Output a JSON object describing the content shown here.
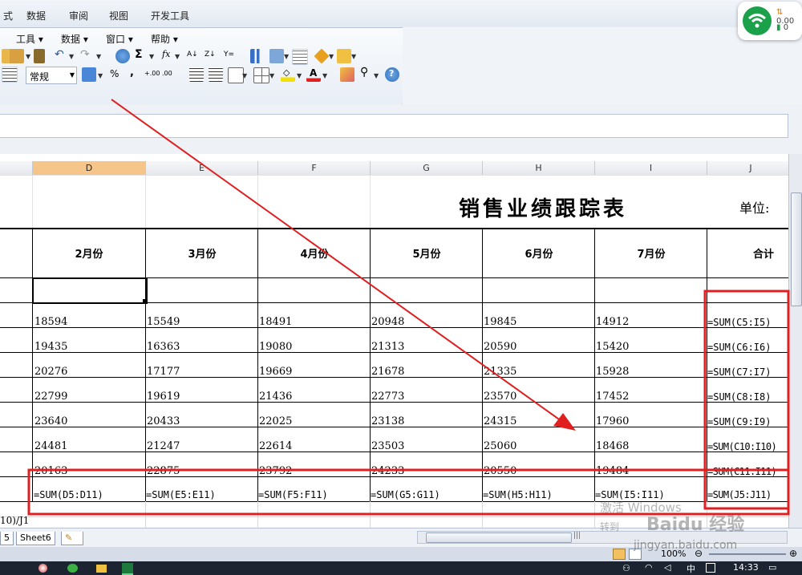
{
  "ribbon": {
    "tabs": [
      "式",
      "数据",
      "审阅",
      "视图",
      "开发工具"
    ]
  },
  "menu": {
    "items": [
      "工具",
      "数据",
      "窗口",
      "帮助"
    ]
  },
  "toolbar": {
    "number_format": "常规",
    "percent": "%",
    "comma": ",",
    "sigma": "Σ",
    "fx": "fx"
  },
  "network_widget": {
    "speed": "0.00",
    "count": "0"
  },
  "columns": [
    "D",
    "E",
    "F",
    "G",
    "H",
    "I",
    "J"
  ],
  "selected_column": "D",
  "sheet": {
    "title": "销售业绩跟踪表",
    "unit_label": "单位:",
    "headers": [
      "2月份",
      "3月份",
      "4月份",
      "5月份",
      "6月份",
      "7月份",
      "合计"
    ],
    "rows": [
      [
        "18594",
        "15549",
        "18491",
        "20948",
        "19845",
        "14912",
        "=SUM(C5:I5)"
      ],
      [
        "19435",
        "16363",
        "19080",
        "21313",
        "20590",
        "15420",
        "=SUM(C6:I6)"
      ],
      [
        "20276",
        "17177",
        "19669",
        "21678",
        "21335",
        "15928",
        "=SUM(C7:I7)"
      ],
      [
        "22799",
        "19619",
        "21436",
        "22773",
        "23570",
        "17452",
        "=SUM(C8:I8)"
      ],
      [
        "23640",
        "20433",
        "22025",
        "23138",
        "24315",
        "17960",
        "=SUM(C9:I9)"
      ],
      [
        "24481",
        "21247",
        "22614",
        "23503",
        "25060",
        "18468",
        "=SUM(C10:I10)"
      ],
      [
        "20163",
        "22875",
        "23792",
        "24233",
        "20550",
        "19484",
        "=SUM(C11:I11)"
      ]
    ],
    "totals": [
      "=SUM(D5:D11)",
      "=SUM(E5:E11)",
      "=SUM(F5:F11)",
      "=SUM(G5:G11)",
      "=SUM(H5:H11)",
      "=SUM(I5:I11)",
      "=SUM(J5:J11)"
    ],
    "partial_formula": "10)/J1"
  },
  "sheet_tabs": [
    "5",
    "Sheet6"
  ],
  "status": {
    "zoom": "100%",
    "scroll_marker": "|||"
  },
  "taskbar": {
    "ime": "中",
    "time": "14:33"
  },
  "watermark": {
    "line1": "激活 Windows",
    "line2": "转到",
    "site": "jingyan.baidu.com",
    "brand": "Baidu 经验"
  },
  "colors": {
    "annotation_red": "#e02020",
    "selected_col": "#f6c58a",
    "wifi_green": "#1aa14a"
  }
}
